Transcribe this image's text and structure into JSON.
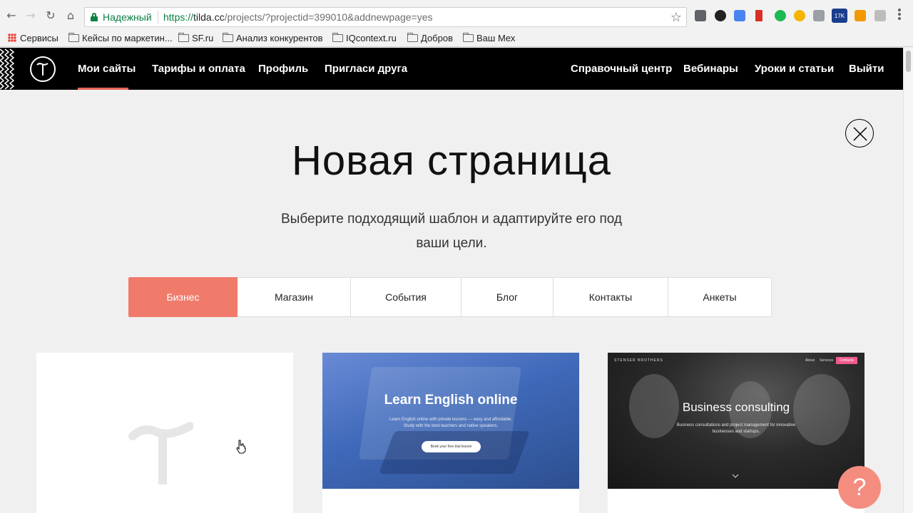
{
  "browser": {
    "secure_label": "Надежный",
    "url_scheme": "https://",
    "url_host": "tilda.cc",
    "url_path": "/projects/?projectid=399010&addnewpage=yes",
    "extension_badge": "17K",
    "bookmarks": [
      {
        "label": "Сервисы",
        "icon": "apps-icon"
      },
      {
        "label": "Кейсы по маркетин...",
        "icon": "folder-icon"
      },
      {
        "label": "SF.ru",
        "icon": "folder-icon"
      },
      {
        "label": "Анализ конкурентов",
        "icon": "folder-icon"
      },
      {
        "label": "IQcontext.ru",
        "icon": "folder-icon"
      },
      {
        "label": "Добров",
        "icon": "folder-icon"
      },
      {
        "label": "Ваш Мех",
        "icon": "folder-icon"
      }
    ]
  },
  "header": {
    "nav_left": [
      "Мои сайты",
      "Тарифы и оплата",
      "Профиль",
      "Пригласи друга"
    ],
    "nav_right": [
      "Справочный центр",
      "Вебинары",
      "Уроки и статьи",
      "Выйти"
    ],
    "accent_color": "#e8635b"
  },
  "main": {
    "title": "Новая страница",
    "subtitle_line1": "Выберите подходящий шаблон и адаптируйте его под",
    "subtitle_line2": "ваши цели.",
    "tabs": [
      "Бизнес",
      "Магазин",
      "События",
      "Блог",
      "Контакты",
      "Анкеты"
    ],
    "active_tab": "Бизнес",
    "active_color": "#f07b6b"
  },
  "templates": {
    "english": {
      "title": "Learn English online",
      "subtitle_line1": "Learn English online with private lessons — easy and affordable.",
      "subtitle_line2": "Study with the best teachers and native speakers.",
      "button": "Book your free trial lesson"
    },
    "business": {
      "brand": "STENSER BROTHERS",
      "nav": [
        "About",
        "Services"
      ],
      "contact_button": "Contacts",
      "title": "Business consulting",
      "subtitle_line1": "Business consultations and project management for innovative",
      "subtitle_line2": "businesses and startups."
    }
  },
  "help": {
    "label": "?"
  }
}
